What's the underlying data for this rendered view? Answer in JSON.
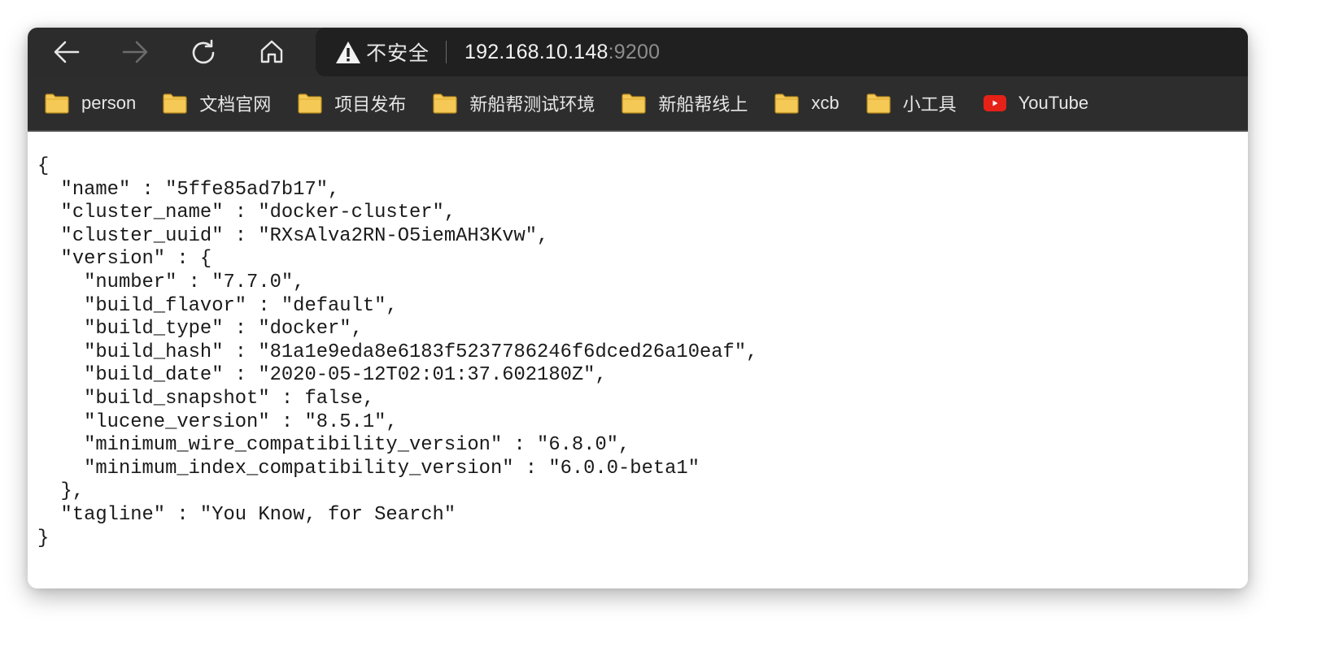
{
  "browser": {
    "nav": {
      "back": "back-arrow",
      "forward": "forward-arrow",
      "reload": "reload",
      "home": "home"
    },
    "address": {
      "security_icon": "warning-triangle",
      "security_label": "不安全",
      "host": "192.168.10.148",
      "port": ":9200"
    },
    "bookmarks": [
      {
        "label": "person",
        "icon": "folder"
      },
      {
        "label": "文档官网",
        "icon": "folder"
      },
      {
        "label": "项目发布",
        "icon": "folder"
      },
      {
        "label": "新船帮测试环境",
        "icon": "folder"
      },
      {
        "label": "新船帮线上",
        "icon": "folder"
      },
      {
        "label": "xcb",
        "icon": "folder"
      },
      {
        "label": "小工具",
        "icon": "folder"
      },
      {
        "label": "YouTube",
        "icon": "youtube"
      }
    ],
    "colors": {
      "folder": "#f5c955",
      "youtube": "#e62117",
      "toolbar": "#2c2c2c",
      "address_bg": "#202020"
    }
  },
  "document": {
    "lines": [
      "{",
      "  \"name\" : \"5ffe85ad7b17\",",
      "  \"cluster_name\" : \"docker-cluster\",",
      "  \"cluster_uuid\" : \"RXsAlva2RN-O5iemAH3Kvw\",",
      "  \"version\" : {",
      "    \"number\" : \"7.7.0\",",
      "    \"build_flavor\" : \"default\",",
      "    \"build_type\" : \"docker\",",
      "    \"build_hash\" : \"81a1e9eda8e6183f5237786246f6dced26a10eaf\",",
      "    \"build_date\" : \"2020-05-12T02:01:37.602180Z\",",
      "    \"build_snapshot\" : false,",
      "    \"lucene_version\" : \"8.5.1\",",
      "    \"minimum_wire_compatibility_version\" : \"6.8.0\",",
      "    \"minimum_index_compatibility_version\" : \"6.0.0-beta1\"",
      "  },",
      "  \"tagline\" : \"You Know, for Search\"",
      "}"
    ]
  }
}
